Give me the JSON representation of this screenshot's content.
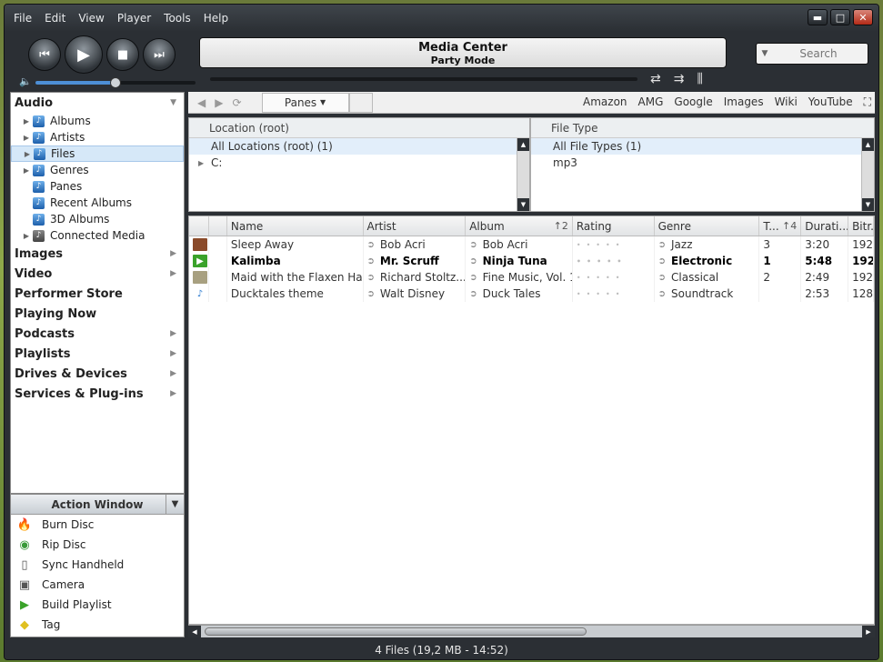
{
  "menu": [
    "File",
    "Edit",
    "View",
    "Player",
    "Tools",
    "Help"
  ],
  "window_controls": {
    "minimize": "▬",
    "maximize": "□",
    "close": "✕"
  },
  "transport": {
    "prev": "⏮",
    "play": "▶",
    "stop": "■",
    "next": "⏭"
  },
  "volume": {
    "icon": "speaker-icon",
    "level": 0.5
  },
  "display": {
    "title": "Media Center",
    "subtitle": "Party Mode"
  },
  "mode_icons": [
    "repeat-icon",
    "shuffle-icon",
    "equalizer-icon"
  ],
  "search": {
    "placeholder": "Search"
  },
  "tree": {
    "audio_header": "Audio",
    "audio_items": [
      {
        "label": "Albums",
        "expandable": true
      },
      {
        "label": "Artists",
        "expandable": true
      },
      {
        "label": "Files",
        "expandable": true,
        "selected": true
      },
      {
        "label": "Genres",
        "expandable": true
      },
      {
        "label": "Panes",
        "expandable": false
      },
      {
        "label": "Recent Albums",
        "expandable": false
      },
      {
        "label": "3D Albums",
        "expandable": false
      },
      {
        "label": "Connected Media",
        "expandable": true
      }
    ],
    "sections": [
      {
        "label": "Images",
        "arrow": true
      },
      {
        "label": "Video",
        "arrow": true
      },
      {
        "label": "Performer Store",
        "arrow": false
      },
      {
        "label": "Playing Now",
        "arrow": false
      },
      {
        "label": "Podcasts",
        "arrow": true
      },
      {
        "label": "Playlists",
        "arrow": true
      },
      {
        "label": "Drives & Devices",
        "arrow": true
      },
      {
        "label": "Services & Plug-ins",
        "arrow": true
      }
    ]
  },
  "action_window": {
    "title": "Action Window",
    "items": [
      {
        "label": "Burn Disc",
        "icon": "burn-disc-icon"
      },
      {
        "label": "Rip Disc",
        "icon": "rip-disc-icon"
      },
      {
        "label": "Sync Handheld",
        "icon": "handheld-icon"
      },
      {
        "label": "Camera",
        "icon": "camera-icon"
      },
      {
        "label": "Build Playlist",
        "icon": "build-playlist-icon"
      },
      {
        "label": "Tag",
        "icon": "tag-icon"
      }
    ]
  },
  "toolbar": {
    "panes_label": "Panes",
    "links": [
      "Amazon",
      "AMG",
      "Google",
      "Images",
      "Wiki",
      "YouTube"
    ]
  },
  "panes": {
    "location": {
      "header": "Location (root)",
      "rows": [
        "All Locations (root) (1)",
        "C:"
      ]
    },
    "file_type": {
      "header": "File Type",
      "rows": [
        "All File Types (1)",
        "mp3"
      ]
    }
  },
  "list": {
    "columns": [
      "",
      "",
      "Name",
      "Artist",
      "Album",
      "Rating",
      "Genre",
      "T...",
      "Durati...",
      "Bitr..."
    ],
    "album_sort": "↑2",
    "track_sort": "↑4",
    "rows": [
      {
        "name": "Sleep Away",
        "artist": "Bob Acri",
        "album": "Bob Acri",
        "genre": "Jazz",
        "track": "3",
        "duration": "3:20",
        "bitrate": "192",
        "bold": false,
        "thumb_color": "#8a4a2a",
        "thumb_glyph": ""
      },
      {
        "name": "Kalimba",
        "artist": "Mr. Scruff",
        "album": "Ninja Tuna",
        "genre": "Electronic",
        "track": "1",
        "duration": "5:48",
        "bitrate": "192",
        "bold": true,
        "thumb_color": "#3aa22a",
        "thumb_glyph": "▶"
      },
      {
        "name": "Maid with the Flaxen Hair",
        "artist": "Richard Stoltz...",
        "album": "Fine Music, Vol. 1",
        "genre": "Classical",
        "track": "2",
        "duration": "2:49",
        "bitrate": "192",
        "bold": false,
        "thumb_color": "#a8a080",
        "thumb_glyph": ""
      },
      {
        "name": "Ducktales theme",
        "artist": "Walt Disney",
        "album": "Duck Tales",
        "genre": "Soundtrack",
        "track": "",
        "duration": "2:53",
        "bitrate": "128",
        "bold": false,
        "thumb_color": "#ffffff",
        "thumb_glyph": "♪"
      }
    ]
  },
  "status": "4 Files (19,2 MB - 14:52)"
}
